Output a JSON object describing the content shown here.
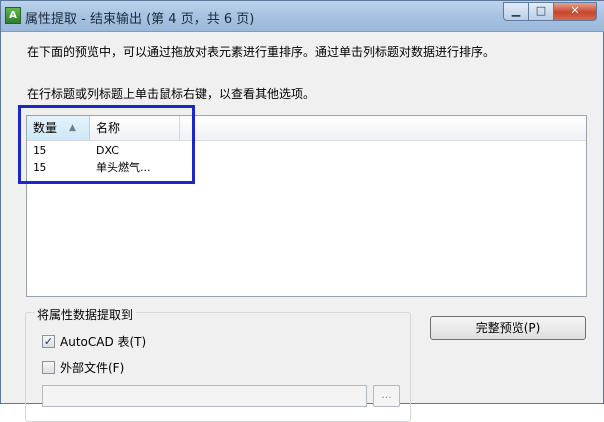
{
  "window": {
    "title": "属性提取 - 结束输出 (第 4 页，共 6 页)",
    "icon": "autocad-app-icon",
    "controls": {
      "minimize": "minimize-icon",
      "maximize": "maximize-icon",
      "close": "close-icon"
    }
  },
  "instructions": {
    "line1": "在下面的预览中，可以通过拖放对表元素进行重排序。通过单击列标题对数据进行排序。",
    "line2": "在行标题或列标题上单击鼠标右键，以查看其他选项。"
  },
  "preview_table": {
    "columns": [
      "数量",
      "名称"
    ],
    "sort_indicator": "▲",
    "rows": [
      [
        "15",
        "DXC"
      ],
      [
        "15",
        "单头燃气..."
      ]
    ]
  },
  "extract_group": {
    "title": "将属性数据提取到",
    "autocad_table": {
      "label": "AutoCAD 表(T)",
      "checked": true
    },
    "external_file": {
      "label": "外部文件(F)",
      "checked": false
    },
    "file_path": "",
    "browse_label": "..."
  },
  "buttons": {
    "full_preview": "完整预览(P)"
  },
  "colors": {
    "highlight_border": "#1d27c9",
    "title_bar": "#a9c3e2",
    "dialog_bg": "#f0f0f0"
  }
}
